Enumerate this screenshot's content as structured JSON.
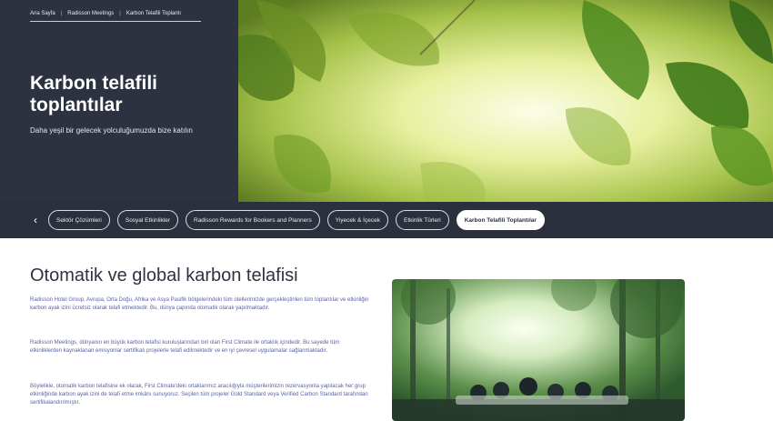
{
  "breadcrumb": {
    "items": [
      "Ana Sayfa",
      "Radisson Meetings",
      "Karbon Telafili Toplantı"
    ],
    "separator": "|"
  },
  "hero": {
    "title": "Karbon telafili toplantılar",
    "subtitle": "Daha yeşil bir gelecek yolculuğumuzda bize katılın"
  },
  "pills": {
    "prev_icon": "chevron-left-icon",
    "items": [
      "Sektör Çözümleri",
      "Sosyal Etkinlikler",
      "Radisson Rewards for Bookers and Planners",
      "Yiyecek & İçecek",
      "Etkinlik Türleri",
      "Karbon Telafili Toplantılar"
    ],
    "active": "Karbon Telafili Toplantılar"
  },
  "section": {
    "title": "Otomatik ve global karbon telafisi",
    "paragraphs": [
      "Radisson Hotel Group, Avrupa, Orta Doğu, Afrika ve Asya Pasifik bölgelerindeki tüm otellerimizde gerçekleştirilen tüm toplantılar ve etkinliğin karbon ayak izini ücretsiz olarak telafi etmektedir. Bu, dünya çapında otomatik olarak yapılmaktadır.",
      "Radisson Meetings, dünyanın en büyük karbon telafisi kuruluşlarından biri olan First Climate ile ortaklık içindedir. Bu sayede tüm etkinliklerden kaynaklanan emisyonlar sertifikalı projelerle telafi edilmektedir ve en iyi çevresel uygulamalar sağlanmaktadır.",
      "Böylelikle, otomatik karbon telafisine ek olarak, First Climate'deki ortaklarımız aracılığıyla müşterilerimizin rezervasyonla yapılacak her grup etkinliğinde karbon ayak izini de telafi etme imkânı sunuyoruz. Seçilen tüm projeler Gold Standard veya Verified Carbon Standard tarafından sertifikalandırılmıştır."
    ]
  },
  "colors": {
    "hero_bg": "#2d3240",
    "pill_bar_bg": "#2b303d",
    "heading_text": "#2f3340",
    "body_text": "#5a63a8"
  },
  "images": {
    "hero": "sunlit-green-leaves",
    "section": "outdoor-meeting-under-trees"
  }
}
